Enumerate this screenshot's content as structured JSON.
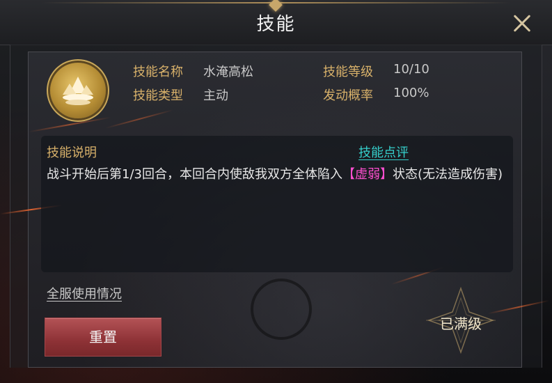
{
  "window": {
    "title": "技能"
  },
  "skill": {
    "name_label": "技能名称",
    "name_value": "水淹高松",
    "level_label": "技能等级",
    "level_value": "10/10",
    "type_label": "技能类型",
    "type_value": "主动",
    "rate_label": "发动概率",
    "rate_value": "100%",
    "icon": "mountain-mist-icon"
  },
  "description": {
    "title": "技能说明",
    "review_label": "技能点评",
    "text_before": "战斗开始后第1/3回合，本回合内使敌我双方全体陷入",
    "highlight": "【虚弱】",
    "text_after": "状态(无法造成伤害)"
  },
  "footer": {
    "usage_label": "全服使用情况",
    "reset_label": "重置",
    "maxed_label": "已满级"
  },
  "colors": {
    "label_gold": "#d8b16a",
    "link_cyan": "#35d0cc",
    "highlight_magenta": "#ff4fd0",
    "button_red": "#8e3236"
  }
}
